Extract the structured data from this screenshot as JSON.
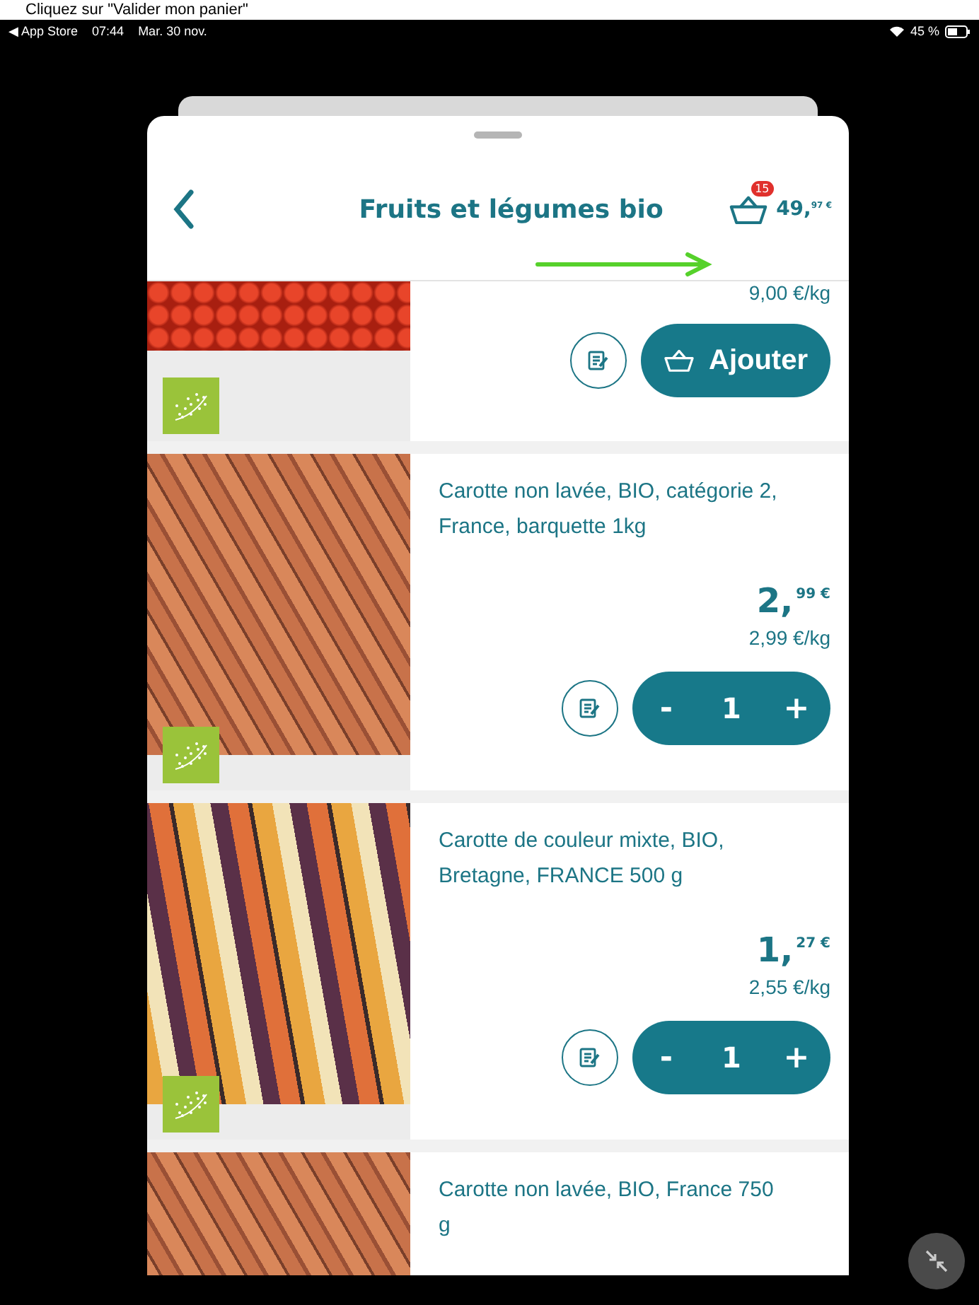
{
  "caption": "Cliquez sur \"Valider mon panier\"",
  "status_bar": {
    "back_app": "◀ App Store",
    "time": "07:44",
    "date": "Mar. 30 nov.",
    "battery": "45 %"
  },
  "header": {
    "title": "Fruits et légumes bio",
    "cart_count": "15",
    "total_main": "49,",
    "total_cents": "97 €"
  },
  "products": [
    {
      "kind": "add",
      "unit_price": "9,00 €/kg",
      "button": "Ajouter"
    },
    {
      "kind": "quantity",
      "name": "Carotte non lavée, BIO, catégorie 2, France, barquette 1kg",
      "price_main": "2,",
      "price_cents": "99 €",
      "unit_price": "2,99 €/kg",
      "minus": "-",
      "quantity": "1",
      "plus": "+"
    },
    {
      "kind": "quantity",
      "name": "Carotte de couleur mixte, BIO, Bretagne, FRANCE 500 g",
      "price_main": "1,",
      "price_cents": "27 €",
      "unit_price": "2,55 €/kg",
      "minus": "-",
      "quantity": "1",
      "plus": "+"
    },
    {
      "kind": "partial",
      "name": "Carotte non lavée, BIO, France 750 g"
    }
  ]
}
